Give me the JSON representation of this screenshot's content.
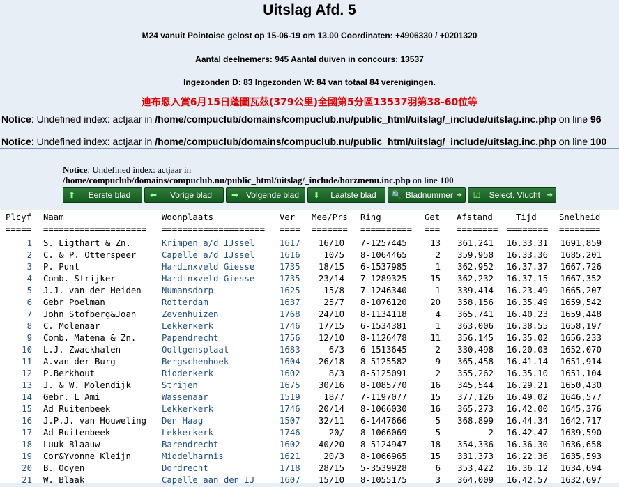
{
  "title": "Uitslag Afd. 5",
  "info_lines": [
    "M24 vanuit Pointoise gelost op 15-06-19 om 13.00 Coordinaten: +4906330 / +0201320",
    "Aantal deelnemers: 945 Aantal duiven in concours: 13537",
    "Ingezonden D: 83 Ingezonden W: 84 van totaal 84 verenigingen."
  ],
  "cjk_line": "迪布恩入賞6月15日蓬圖瓦茲(379公里)全國第5分區13537羽第38-60位等",
  "notices": [
    {
      "label": "Notice",
      "text": ": Undefined index: actjaar in ",
      "path": "/home/compuclub/domains/compuclub.nu/public_html/uitslag/_include/uitslag.inc.php",
      "online": " on line ",
      "line": "96"
    },
    {
      "label": "Notice",
      "text": ": Undefined index: actjaar in ",
      "path": "/home/compuclub/domains/compuclub.nu/public_html/uitslag/_include/uitslag.inc.php",
      "online": " on line ",
      "line": "100"
    }
  ],
  "notice_menu": {
    "label": "Notice",
    "text": ": Undefined index: actjaar in",
    "path": "/home/compuclub/domains/compuclub.nu/public_html/uitslag/_include/horzmenu.inc.php",
    "online": " on line ",
    "line": "100"
  },
  "menu": [
    {
      "label": "Eerste blad",
      "icon": "up-arrow-icon",
      "glyph": "⬆"
    },
    {
      "label": "Vorige blad",
      "icon": "left-arrow-icon",
      "glyph": "⬅"
    },
    {
      "label": "Volgende blad",
      "icon": "right-arrow-icon",
      "glyph": "➡"
    },
    {
      "label": "Laatste blad",
      "icon": "down-arrow-icon",
      "glyph": "⬇"
    },
    {
      "label": "Bladnummer",
      "icon": "search-icon",
      "glyph": "🔍"
    },
    {
      "label": "Select. Vlucht",
      "icon": "checkbox-icon",
      "glyph": "☑"
    }
  ],
  "columns": [
    "Plcyf",
    "Naam",
    "Woonplaats",
    "Ver",
    "Mee/Prs",
    "Ring",
    "Get",
    "Afstand",
    "Tijd",
    "Snelheid"
  ],
  "underlines": [
    "=====",
    "====================",
    "====================",
    "====",
    "=======",
    "==========",
    "===",
    "========",
    "========",
    "========"
  ],
  "rows": [
    [
      "1",
      "S. Ligthart & Zn.",
      "Krimpen a/d IJssel",
      "1617",
      "16/10",
      "7-1257445",
      "13",
      "361,241",
      "16.33.31",
      "1691,859"
    ],
    [
      "2",
      "C. & P. Otterspeer",
      "Capelle a/d IJssel",
      "1616",
      "10/5",
      "8-1064465",
      "2",
      "359,958",
      "16.33.36",
      "1685,201"
    ],
    [
      "3",
      "P. Punt",
      "Hardinxveld Giesse",
      "1735",
      "18/15",
      "6-1537985",
      "1",
      "362,952",
      "16.37.37",
      "1667,726"
    ],
    [
      "4",
      "Comb. Strijker",
      "Hardinxveld Giesse",
      "1735",
      "23/14",
      "7-1289325",
      "15",
      "362,232",
      "16.37.15",
      "1667,352"
    ],
    [
      "5",
      "J.J. van der Heiden",
      "Numansdorp",
      "1625",
      "15/8",
      "7-1246340",
      "1",
      "339,414",
      "16.23.49",
      "1665,207"
    ],
    [
      "6",
      "Gebr Poelman",
      "Rotterdam",
      "1637",
      "25/7",
      "8-1076120",
      "20",
      "358,156",
      "16.35.49",
      "1659,542"
    ],
    [
      "7",
      "John Stofberg&Joan",
      "Zevenhuizen",
      "1768",
      "24/10",
      "8-1134118",
      "4",
      "365,741",
      "16.40.23",
      "1659,448"
    ],
    [
      "8",
      "C. Molenaar",
      "Lekkerkerk",
      "1746",
      "17/15",
      "6-1534381",
      "1",
      "363,006",
      "16.38.55",
      "1658,197"
    ],
    [
      "9",
      "Comb. Matena & Zn.",
      "Papendrecht",
      "1756",
      "12/10",
      "8-1126478",
      "11",
      "356,145",
      "16.35.02",
      "1656,233"
    ],
    [
      "10",
      "L.J. Zwackhalen",
      "Ooltgensplaat",
      "1683",
      "6/3",
      "6-1513645",
      "2",
      "330,498",
      "16.20.03",
      "1652,070"
    ],
    [
      "11",
      "A.van der Burg",
      "Bergschenhoek",
      "1604",
      "26/18",
      "8-5125582",
      "9",
      "365,458",
      "16.41.14",
      "1651,914"
    ],
    [
      "12",
      "P.Berkhout",
      "Ridderkerk",
      "1602",
      "8/3",
      "8-5125091",
      "2",
      "355,262",
      "16.35.10",
      "1651,104"
    ],
    [
      "13",
      "J. & W. Molendijk",
      "Strijen",
      "1675",
      "30/16",
      "8-1085770",
      "16",
      "345,544",
      "16.29.21",
      "1650,430"
    ],
    [
      "14",
      "Gebr. L'Ami",
      "Wassenaar",
      "1519",
      "18/7",
      "7-1197077",
      "15",
      "377,126",
      "16.49.02",
      "1646,577"
    ],
    [
      "15",
      "Ad Ruitenbeek",
      "Lekkerkerk",
      "1746",
      "20/14",
      "8-1066030",
      "16",
      "365,273",
      "16.42.00",
      "1645,376"
    ],
    [
      "16",
      "J.P.J. van Houweling",
      "Den Haag",
      "1507",
      "32/11",
      "6-1447666",
      "5",
      "368,899",
      "16.44.34",
      "1642,717"
    ],
    [
      "17",
      "Ad Ruitenbeek",
      "Lekkerkerk",
      "1746",
      "20/",
      "8-1066069",
      "5",
      "2",
      "16.42.47",
      "1639,590"
    ],
    [
      "18",
      "Luuk Blaauw",
      "Barendrecht",
      "1602",
      "40/20",
      "8-5124947",
      "18",
      "354,336",
      "16.36.30",
      "1636,658"
    ],
    [
      "19",
      "Cor&Yvonne Kleijn",
      "Middelharnis",
      "1621",
      "20/3",
      "8-1066965",
      "15",
      "331,373",
      "16.22.36",
      "1635,593"
    ],
    [
      "20",
      "B. Ooyen",
      "Dordrecht",
      "1718",
      "28/15",
      "5-3539928",
      "6",
      "353,422",
      "16.36.12",
      "1634,694"
    ],
    [
      "21",
      "W. Blaak",
      "Capelle aan den IJ",
      "1607",
      "15/10",
      "8-1055175",
      "3",
      "364,009",
      "16.42.57",
      "1632,697"
    ]
  ]
}
